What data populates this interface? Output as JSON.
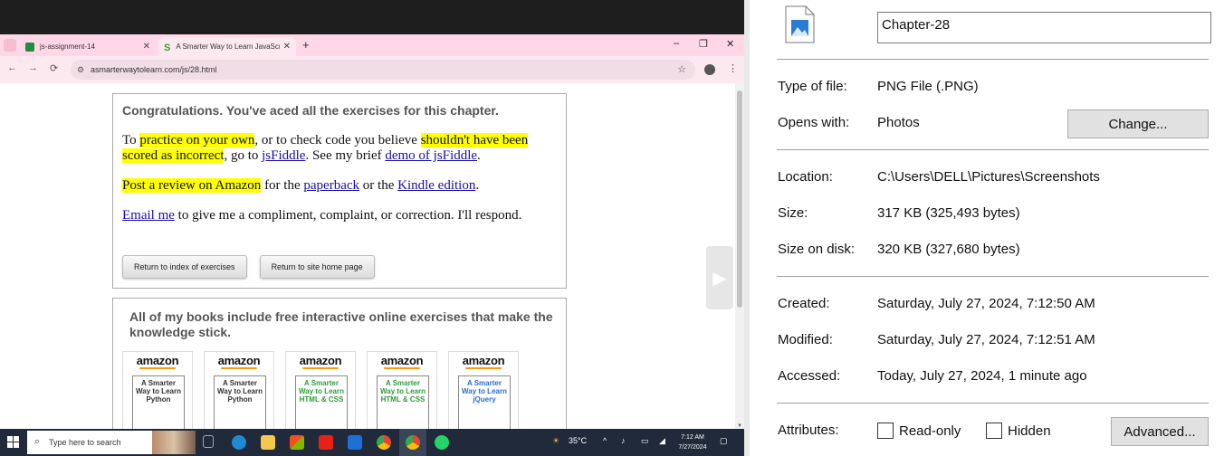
{
  "browser": {
    "tabs": [
      {
        "title": "js-assignment-14",
        "favicon_color": "#1e8e3e",
        "active": false
      },
      {
        "title": "A Smarter Way to Learn JavaScript",
        "favicon_glyph": "S",
        "favicon_color": "#3a9d23",
        "active": true
      }
    ],
    "new_tab_glyph": "+",
    "window_controls": {
      "minimize": "–",
      "restore": "❐",
      "close": "✕"
    },
    "url": "asmarterwaytolearn.com/js/28.html",
    "nav_glyphs": {
      "back": "←",
      "forward": "→",
      "reload": "⟳"
    }
  },
  "page": {
    "congrats_heading": "Congratulations. You've aced all the exercises for this chapter.",
    "para1": {
      "t1": "To ",
      "h1": "practice on your own",
      "t2": ", or to check code you believe ",
      "h2": "shouldn't have been scored as incorrect",
      "t3": ", go to ",
      "link1": "jsFiddle",
      "t4": ". See my brief ",
      "link2": "demo of jsFiddle",
      "t5": "."
    },
    "para2": {
      "h1": "Post a review on Amazon",
      "t1": " for the ",
      "link1": "paperback",
      "t2": " or the ",
      "link2": "Kindle edition",
      "t3": "."
    },
    "para3": {
      "link1": "Email me",
      "t1": " to give me a compliment, complaint, or correction. I'll respond."
    },
    "buttons": {
      "index": "Return to index of exercises",
      "home": "Return to site home page"
    },
    "books_heading": "All of my books include free interactive online exercises that make the knowledge stick.",
    "books": [
      {
        "brand": "amazon",
        "title": "A Smarter Way to Learn Python",
        "color": "#333333"
      },
      {
        "brand": "amazon",
        "title": "A Smarter Way to Learn Python",
        "color": "#333333"
      },
      {
        "brand": "amazon",
        "title": "A Smarter Way to Learn HTML & CSS",
        "color": "#2e9a3a"
      },
      {
        "brand": "amazon",
        "title": "A Smarter Way to Learn HTML & CSS",
        "color": "#2e9a3a"
      },
      {
        "brand": "amazon",
        "title": "A Smarter Way to Learn jQuery",
        "color": "#2a6bd1"
      }
    ]
  },
  "taskbar": {
    "search_placeholder": "Type here to search",
    "weather": "35°C",
    "time": "7:12 AM",
    "date": "7/27/2024"
  },
  "properties": {
    "file_name": "Chapter-28",
    "type_label": "Type of file:",
    "type_value": "PNG File (.PNG)",
    "opens_label": "Opens with:",
    "opens_value": "Photos",
    "change_button": "Change...",
    "location_label": "Location:",
    "location_value": "C:\\Users\\DELL\\Pictures\\Screenshots",
    "size_label": "Size:",
    "size_value": "317 KB (325,493 bytes)",
    "size_disk_label": "Size on disk:",
    "size_disk_value": "320 KB (327,680 bytes)",
    "created_label": "Created:",
    "created_value": "Saturday, July 27, 2024, 7:12:50 AM",
    "modified_label": "Modified:",
    "modified_value": "Saturday, July 27, 2024, 7:12:51 AM",
    "accessed_label": "Accessed:",
    "accessed_value": "Today, July 27, 2024, 1 minute ago",
    "attributes_label": "Attributes:",
    "readonly_label": "Read-only",
    "hidden_label": "Hidden",
    "advanced_button": "Advanced..."
  }
}
